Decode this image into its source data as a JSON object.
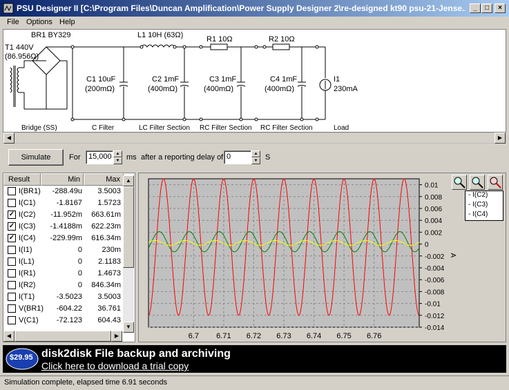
{
  "window": {
    "title": "PSU Designer II  [C:\\Program Files\\Duncan Amplification\\Power Supply Designer 2\\re-designed kt90 psu-21-Jense..."
  },
  "menu": [
    "File",
    "Options",
    "Help"
  ],
  "schematic": {
    "transformer": "T1 440V",
    "transformer_res": "(86.956Ω)",
    "rectifier": "BR1 BY329",
    "inductor": "L1 10H (63Ω)",
    "r1": "R1 10Ω",
    "r2": "R2 10Ω",
    "c1": "C1 10uF",
    "c1_esr": "(200mΩ)",
    "c2": "C2 1mF",
    "c2_esr": "(400mΩ)",
    "c3": "C3 1mF",
    "c3_esr": "(400mΩ)",
    "c4": "C4 1mF",
    "c4_esr": "(400mΩ)",
    "load_name": "I1",
    "load_val": "230mA",
    "sections": [
      "Bridge (SS)",
      "C Filter",
      "LC Filter Section",
      "RC Filter Section",
      "RC Filter Section",
      "Load"
    ]
  },
  "controls": {
    "simulate": "Simulate",
    "for_label": "For",
    "duration": "15,000",
    "ms_label": "ms",
    "after_label": "after a reporting delay of",
    "delay": "0",
    "s_label": "S"
  },
  "table": {
    "headers": [
      "Result",
      "Min",
      "Max"
    ],
    "rows": [
      {
        "name": "I(BR1)",
        "min": "-288.49u",
        "max": "3.5003",
        "checked": false
      },
      {
        "name": "I(C1)",
        "min": "-1.8167",
        "max": "1.5723",
        "checked": false
      },
      {
        "name": "I(C2)",
        "min": "-11.952m",
        "max": "663.61m",
        "checked": true
      },
      {
        "name": "I(C3)",
        "min": "-1.4188m",
        "max": "622.23m",
        "checked": true
      },
      {
        "name": "I(C4)",
        "min": "-229.99m",
        "max": "616.34m",
        "checked": true
      },
      {
        "name": "I(I1)",
        "min": "0",
        "max": "230m",
        "checked": false
      },
      {
        "name": "I(L1)",
        "min": "0",
        "max": "2.1183",
        "checked": false
      },
      {
        "name": "I(R1)",
        "min": "0",
        "max": "1.4673",
        "checked": false
      },
      {
        "name": "I(R2)",
        "min": "0",
        "max": "846.34m",
        "checked": false
      },
      {
        "name": "I(T1)",
        "min": "-3.5023",
        "max": "3.5003",
        "checked": false
      },
      {
        "name": "V(BR1)",
        "min": "-604.22",
        "max": "36.761",
        "checked": false
      },
      {
        "name": "V(C1)",
        "min": "-72.123",
        "max": "604.43",
        "checked": false
      }
    ]
  },
  "legend": [
    "I(C2)",
    "I(C3)",
    "I(C4)"
  ],
  "chart_data": {
    "type": "line",
    "xlim": [
      6.685,
      6.775
    ],
    "ylim": [
      -0.014,
      0.011
    ],
    "x_ticks": [
      "6.7",
      "6.71",
      "6.72",
      "6.73",
      "6.74",
      "6.75",
      "6.76"
    ],
    "x_tick_values": [
      6.7,
      6.71,
      6.72,
      6.73,
      6.74,
      6.75,
      6.76
    ],
    "y_ticks": [
      "0.01",
      "0.008",
      "0.006",
      "0.004",
      "0.002",
      "0",
      "-0.002",
      "-0.004",
      "-0.006",
      "-0.008",
      "-0.01",
      "-0.012",
      "-0.014"
    ],
    "y_tick_values": [
      0.01,
      0.008,
      0.006,
      0.004,
      0.002,
      0,
      -0.002,
      -0.004,
      -0.006,
      -0.008,
      -0.01,
      -0.012,
      -0.014
    ],
    "ylabel": "A",
    "grid": true,
    "series": [
      {
        "name": "I(C2)",
        "color": "#ff0000",
        "amplitude": 0.0115,
        "offset": -0.0005,
        "period": 0.01
      },
      {
        "name": "I(C3)",
        "color": "#008000",
        "amplitude": 0.0017,
        "offset": 0.0004,
        "period": 0.01
      },
      {
        "name": "I(C4)",
        "color": "#ffff00",
        "amplitude": 0.0004,
        "offset": 0.0002,
        "period": 0.01
      }
    ]
  },
  "ad": {
    "price": "$29.95",
    "headline": "disk2disk File backup and archiving",
    "link": "Click here to download a trial copy"
  },
  "status": "Simulation complete, elapsed time 6.91 seconds"
}
